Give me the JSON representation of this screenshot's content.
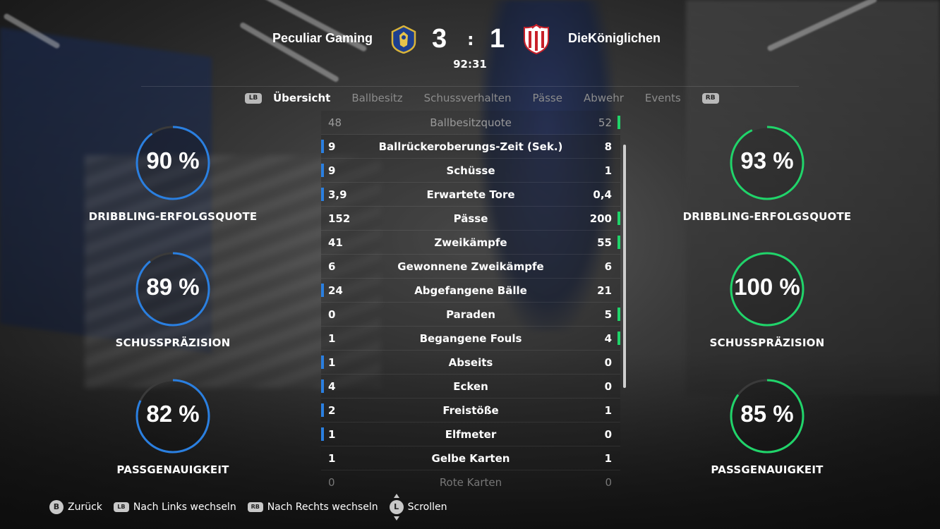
{
  "match": {
    "home_team": "Peculiar Gaming",
    "away_team": "DieKöniglichen",
    "home_score": "3",
    "separator": ":",
    "away_score": "1",
    "clock": "92:31",
    "home_color": "#2a7fe0",
    "away_color": "#20d46a"
  },
  "tabs": {
    "lb": "LB",
    "rb": "RB",
    "items": [
      "Übersicht",
      "Ballbesitz",
      "Schussverhalten",
      "Pässe",
      "Abwehr",
      "Events"
    ],
    "active": "Übersicht"
  },
  "stats": [
    {
      "label": "Ballbesitzquote",
      "home": "48",
      "away": "52",
      "leader": "away",
      "style": "dim"
    },
    {
      "label": "Ballrückeroberungs-Zeit (Sek.)",
      "home": "9",
      "away": "8",
      "leader": "home"
    },
    {
      "label": "Schüsse",
      "home": "9",
      "away": "1",
      "leader": "home"
    },
    {
      "label": "Erwartete Tore",
      "home": "3,9",
      "away": "0,4",
      "leader": "home"
    },
    {
      "label": "Pässe",
      "home": "152",
      "away": "200",
      "leader": "away"
    },
    {
      "label": "Zweikämpfe",
      "home": "41",
      "away": "55",
      "leader": "away"
    },
    {
      "label": "Gewonnene Zweikämpfe",
      "home": "6",
      "away": "6",
      "leader": "none"
    },
    {
      "label": "Abgefangene Bälle",
      "home": "24",
      "away": "21",
      "leader": "home"
    },
    {
      "label": "Paraden",
      "home": "0",
      "away": "5",
      "leader": "away"
    },
    {
      "label": "Begangene Fouls",
      "home": "1",
      "away": "4",
      "leader": "away"
    },
    {
      "label": "Abseits",
      "home": "1",
      "away": "0",
      "leader": "home"
    },
    {
      "label": "Ecken",
      "home": "4",
      "away": "0",
      "leader": "home"
    },
    {
      "label": "Freistöße",
      "home": "2",
      "away": "1",
      "leader": "home"
    },
    {
      "label": "Elfmeter",
      "home": "1",
      "away": "0",
      "leader": "home"
    },
    {
      "label": "Gelbe Karten",
      "home": "1",
      "away": "1",
      "leader": "none"
    },
    {
      "label": "Rote Karten",
      "home": "0",
      "away": "0",
      "leader": "none",
      "style": "faded"
    }
  ],
  "gauges": {
    "home": [
      {
        "value": 90,
        "text": "90 %",
        "label": "DRIBBLING-ERFOLGSQUOTE"
      },
      {
        "value": 89,
        "text": "89 %",
        "label": "SCHUSSPRÄZISION"
      },
      {
        "value": 82,
        "text": "82 %",
        "label": "PASSGENAUIGKEIT"
      }
    ],
    "away": [
      {
        "value": 93,
        "text": "93 %",
        "label": "DRIBBLING-ERFOLGSQUOTE"
      },
      {
        "value": 100,
        "text": "100 %",
        "label": "SCHUSSPRÄZISION"
      },
      {
        "value": 85,
        "text": "85 %",
        "label": "PASSGENAUIGKEIT"
      }
    ]
  },
  "footer": {
    "back_key": "B",
    "back": "Zurück",
    "left_key": "LB",
    "left": "Nach Links wechseln",
    "right_key": "RB",
    "right": "Nach Rechts wechseln",
    "scroll_key": "L",
    "scroll": "Scrollen"
  }
}
